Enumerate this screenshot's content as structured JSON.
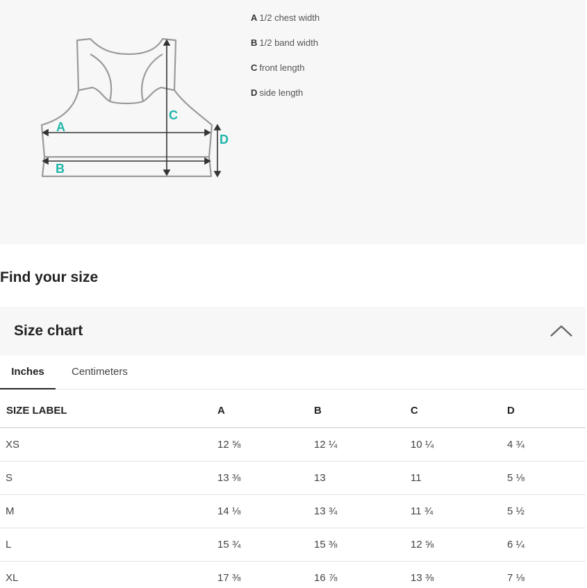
{
  "legend": [
    {
      "key": "A",
      "label": "1/2 chest width"
    },
    {
      "key": "B",
      "label": "1/2 band width"
    },
    {
      "key": "C",
      "label": "front length"
    },
    {
      "key": "D",
      "label": "side length"
    }
  ],
  "diagram": {
    "markers": {
      "a": "A",
      "b": "B",
      "c": "C",
      "d": "D"
    },
    "marker_color": "#1fb5a9",
    "outline_color": "#9a9a9a"
  },
  "find_title": "Find your size",
  "accordion": {
    "title": "Size chart"
  },
  "tabs": [
    {
      "label": "Inches",
      "active": true
    },
    {
      "label": "Centimeters",
      "active": false
    }
  ],
  "table": {
    "headers": [
      "SIZE LABEL",
      "A",
      "B",
      "C",
      "D"
    ],
    "rows": [
      [
        "XS",
        "12 ⅝",
        "12 ¼",
        "10 ¼",
        "4 ¾"
      ],
      [
        "S",
        "13 ⅜",
        "13",
        "11",
        "5 ⅛"
      ],
      [
        "M",
        "14 ⅛",
        "13 ¾",
        "11 ¾",
        "5 ½"
      ],
      [
        "L",
        "15 ¾",
        "15 ⅜",
        "12 ⅝",
        "6 ¼"
      ],
      [
        "XL",
        "17 ⅜",
        "16 ⅞",
        "13 ⅜",
        "7 ⅛"
      ]
    ]
  }
}
